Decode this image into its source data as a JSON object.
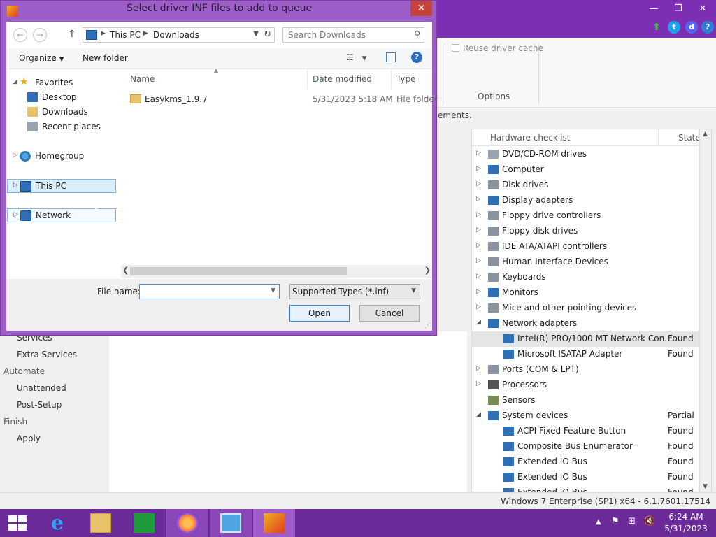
{
  "app": {
    "ribbon": {
      "reuse_driver_cache": "Reuse driver cache",
      "options_group": "Options"
    },
    "info_text": "ements.",
    "left_nav": [
      {
        "label": "Services",
        "kind": "sub"
      },
      {
        "label": "Extra Services",
        "kind": "sub"
      },
      {
        "label": "Automate",
        "kind": "head"
      },
      {
        "label": "Unattended",
        "kind": "sub"
      },
      {
        "label": "Post-Setup",
        "kind": "sub"
      },
      {
        "label": "Finish",
        "kind": "head"
      },
      {
        "label": "Apply",
        "kind": "sub"
      }
    ],
    "hardware": {
      "col_checklist": "Hardware checklist",
      "col_state": "State",
      "rows": [
        {
          "label": "DVD/CD-ROM drives",
          "state": "",
          "level": 0,
          "expand": "▷",
          "icon": "cdrom-icon"
        },
        {
          "label": "Computer",
          "state": "",
          "level": 0,
          "expand": "▷",
          "icon": "computer-icon"
        },
        {
          "label": "Disk drives",
          "state": "",
          "level": 0,
          "expand": "▷",
          "icon": "disk-drive-icon"
        },
        {
          "label": "Display adapters",
          "state": "",
          "level": 0,
          "expand": "▷",
          "icon": "display-adapter-icon"
        },
        {
          "label": "Floppy drive controllers",
          "state": "",
          "level": 0,
          "expand": "▷",
          "icon": "floppy-controller-icon"
        },
        {
          "label": "Floppy disk drives",
          "state": "",
          "level": 0,
          "expand": "▷",
          "icon": "floppy-disk-icon"
        },
        {
          "label": "IDE ATA/ATAPI controllers",
          "state": "",
          "level": 0,
          "expand": "▷",
          "icon": "ide-controller-icon"
        },
        {
          "label": "Human Interface Devices",
          "state": "",
          "level": 0,
          "expand": "▷",
          "icon": "hid-icon"
        },
        {
          "label": "Keyboards",
          "state": "",
          "level": 0,
          "expand": "▷",
          "icon": "keyboard-icon"
        },
        {
          "label": "Monitors",
          "state": "",
          "level": 0,
          "expand": "▷",
          "icon": "monitor-icon"
        },
        {
          "label": "Mice and other pointing devices",
          "state": "",
          "level": 0,
          "expand": "▷",
          "icon": "mouse-icon"
        },
        {
          "label": "Network adapters",
          "state": "",
          "level": 0,
          "expand": "◢",
          "icon": "network-adapter-icon"
        },
        {
          "label": "Intel(R) PRO/1000 MT Network Con...",
          "state": "Found",
          "level": 1,
          "expand": "",
          "icon": "network-adapter-icon",
          "selected": true
        },
        {
          "label": "Microsoft ISATAP Adapter",
          "state": "Found",
          "level": 1,
          "expand": "",
          "icon": "network-adapter-icon"
        },
        {
          "label": "Ports (COM & LPT)",
          "state": "",
          "level": 0,
          "expand": "▷",
          "icon": "port-icon"
        },
        {
          "label": "Processors",
          "state": "",
          "level": 0,
          "expand": "▷",
          "icon": "processor-icon"
        },
        {
          "label": "Sensors",
          "state": "",
          "level": 0,
          "expand": "",
          "icon": "sensor-icon"
        },
        {
          "label": "System devices",
          "state": "Partial",
          "level": 0,
          "expand": "◢",
          "icon": "system-device-icon"
        },
        {
          "label": "ACPI Fixed Feature Button",
          "state": "Found",
          "level": 1,
          "expand": "",
          "icon": "system-device-icon"
        },
        {
          "label": "Composite Bus Enumerator",
          "state": "Found",
          "level": 1,
          "expand": "",
          "icon": "system-device-icon"
        },
        {
          "label": "Extended IO Bus",
          "state": "Found",
          "level": 1,
          "expand": "",
          "icon": "system-device-icon"
        },
        {
          "label": "Extended IO Bus",
          "state": "Found",
          "level": 1,
          "expand": "",
          "icon": "system-device-icon"
        },
        {
          "label": "Extended IO Bus",
          "state": "Found",
          "level": 1,
          "expand": "",
          "icon": "system-device-icon"
        }
      ]
    },
    "status_text": "Windows 7 Enterprise (SP1) x64 - 6.1.7601.17514"
  },
  "dialog": {
    "title": "Select driver INF files to add to queue",
    "address": {
      "segments": [
        "This PC",
        "Downloads"
      ]
    },
    "search_placeholder": "Search Downloads",
    "toolbar": {
      "organize": "Organize",
      "new_folder": "New folder"
    },
    "tree": {
      "favorites": "Favorites",
      "favorites_children": [
        {
          "label": "Desktop",
          "icon": "desktop-icon"
        },
        {
          "label": "Downloads",
          "icon": "downloads-folder-icon"
        },
        {
          "label": "Recent places",
          "icon": "recent-places-icon"
        }
      ],
      "homegroup": "Homegroup",
      "this_pc": "This PC",
      "network": "Network"
    },
    "columns": {
      "name": "Name",
      "date_modified": "Date modified",
      "type": "Type"
    },
    "files": [
      {
        "name": "Easykms_1.9.7",
        "date": "5/31/2023 5:18 AM",
        "type": "File folder"
      }
    ],
    "file_name_label": "File name:",
    "file_name_value": "",
    "file_type": "Supported Types (*.inf)",
    "open_button": "Open",
    "cancel_button": "Cancel"
  },
  "taskbar": {
    "clock_time": "6:24 AM",
    "clock_date": "5/31/2023"
  },
  "colors": {
    "accent": "#7d2fb4",
    "taskbar": "#6a2a98",
    "dialog_frame": "#9d5fc7"
  }
}
